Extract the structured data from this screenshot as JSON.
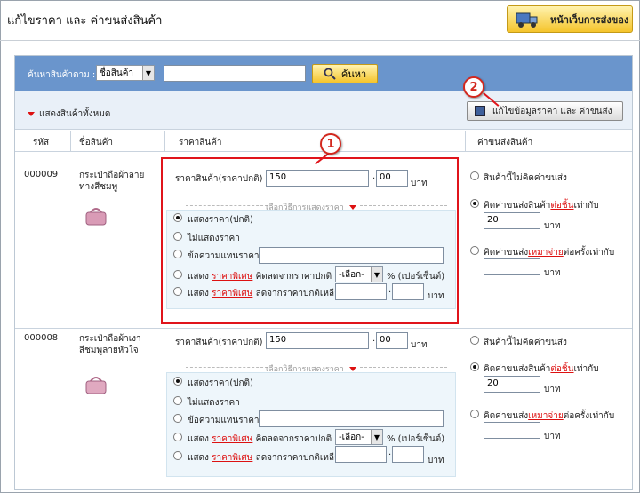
{
  "page": {
    "title": "แก้ไขราคา และ ค่าขนส่งสินค้า",
    "ship_home_label": "หน้าเว็บการส่งของ"
  },
  "search": {
    "label": "ค้นหาสินค้าตาม :",
    "field_selected": "ชื่อสินค้า",
    "query": "",
    "button_label": "ค้นหา"
  },
  "toolbar": {
    "show_all_label": "แสดงสินค้าทั้งหมด",
    "edit_button_label": "แก้ไขข้อมูลราคา และ ค่าขนส่ง"
  },
  "columns": {
    "code": "รหัส",
    "name": "ชื่อสินค้า",
    "price": "ราคาสินค้า",
    "shipping": "ค่าขนส่งสินค้า"
  },
  "badges": {
    "one": "1",
    "two": "2"
  },
  "labels": {
    "price_normal": "ราคาสินค้า(ราคาปกติ)",
    "baht": "บาท",
    "display_options": "เลือกวิธีการแสดงราคา",
    "opt_show_price": "แสดงราคา(ปกติ)",
    "opt_hide_price": "ไม่แสดงราคา",
    "opt_replace_text": "ข้อความแทนราคา",
    "opt_show": "แสดง",
    "special_price": "ราคาพิเศษ",
    "calc_from_normal": "คิดลดจากราคาปกติ =",
    "percent_select": "-เลือก-",
    "percent_unit": "% (เปอร์เซ็นต์)",
    "reduce_to": "ลดจากราคาปกติเหลือ",
    "ship_none": "สินค้านี้ไม่คิดค่าขนส่ง",
    "ship_per_piece_pre": "คิดค่าขนส่งสินค้า",
    "ship_per_piece_link": "ต่อชิ้น",
    "ship_per_piece_post": "เท่ากับ",
    "ship_lump_pre": "คิดค่าขนส่ง",
    "ship_lump_link": "เหมาจ่าย",
    "ship_lump_post": "ต่อครั้งเท่ากับ"
  },
  "products": [
    {
      "code": "000009",
      "name": "กระเป๋าถือผ้าลายทางสีชมพู",
      "price_int": "150",
      "price_dec": "00",
      "ship_per_piece": "20"
    },
    {
      "code": "000008",
      "name": "กระเป๋าถือผ้าเงาสีชมพูลายหัวใจ",
      "price_int": "150",
      "price_dec": "00",
      "ship_per_piece": "20"
    }
  ]
}
